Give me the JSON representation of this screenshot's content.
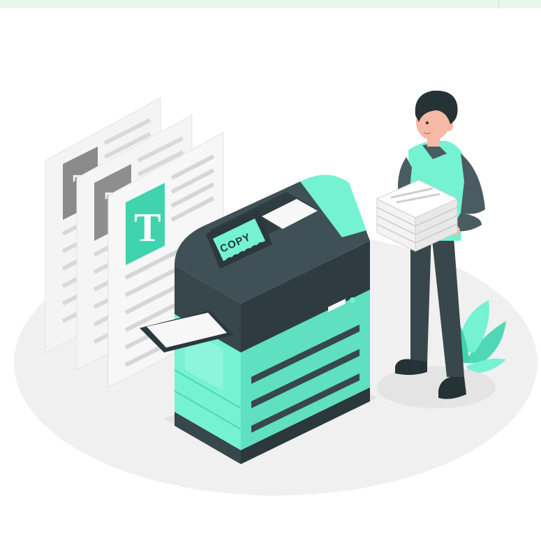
{
  "illustration": {
    "display_label": "COPY",
    "document_glyph": "T",
    "colors": {
      "accent": "#74f2d2",
      "accent_dark": "#4fd8b5",
      "charcoal": "#38474c",
      "charcoal_light": "#4a5b61",
      "paper": "#f3f3f3",
      "paper_lines": "#d6d6d6",
      "floor": "#efefef",
      "skin": "#f5b9a5",
      "hair": "#253236"
    }
  }
}
